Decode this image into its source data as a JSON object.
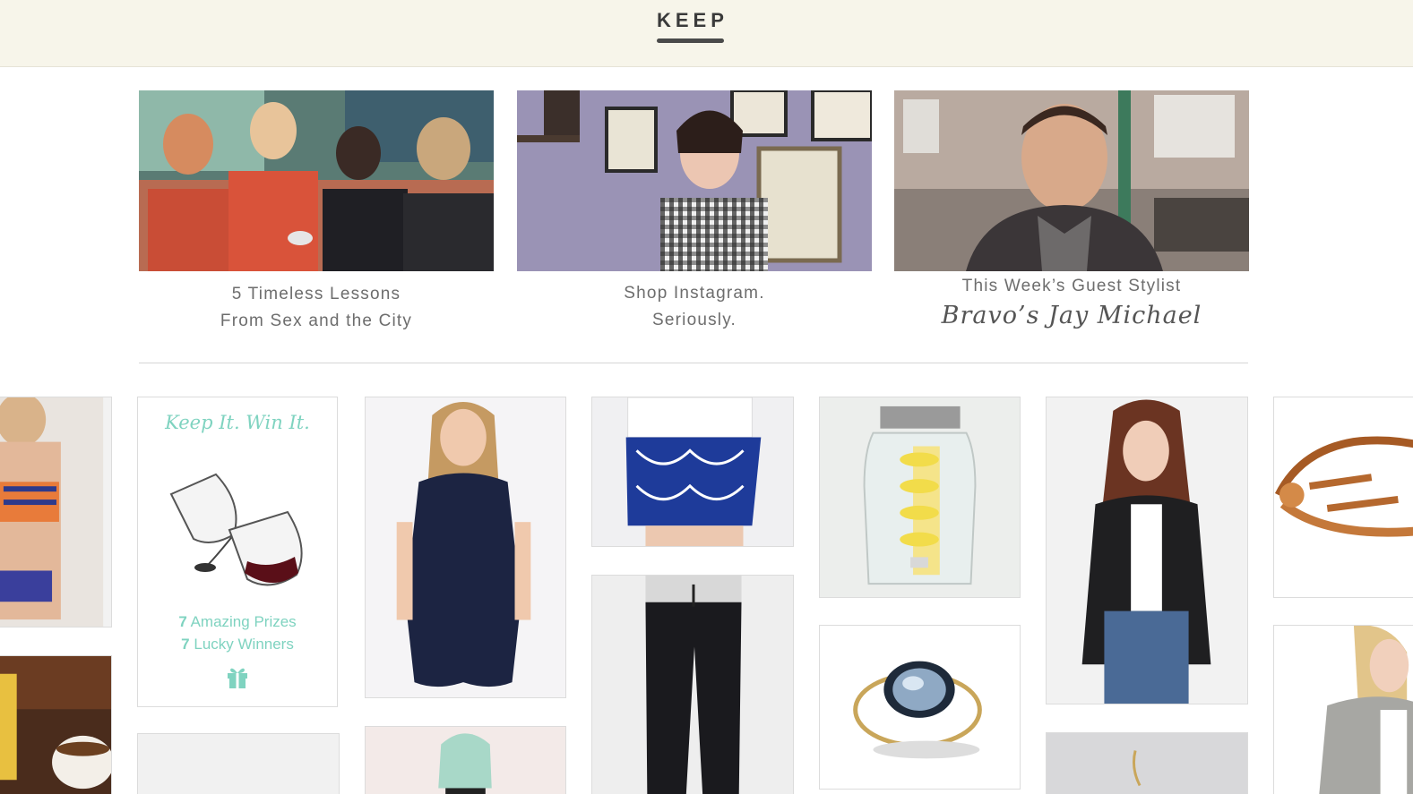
{
  "header": {
    "logo": "KEEP"
  },
  "features": [
    {
      "line1": "5 Timeless Lessons",
      "line2": "From Sex and the City"
    },
    {
      "line1": "Shop Instagram.",
      "line2": "Seriously."
    },
    {
      "line1": "This Week’s Guest Stylist",
      "line2": "Bravo’s Jay Michael"
    }
  ],
  "promo": {
    "title": "Keep It. Win It.",
    "prizes_count": "7",
    "prizes_label": "Amazing Prizes",
    "winners_count": "7",
    "winners_label": "Lucky Winners"
  },
  "colors": {
    "header_bg": "#f7f5ea",
    "accent": "#7fd3c0",
    "text": "#6d6d6d"
  }
}
